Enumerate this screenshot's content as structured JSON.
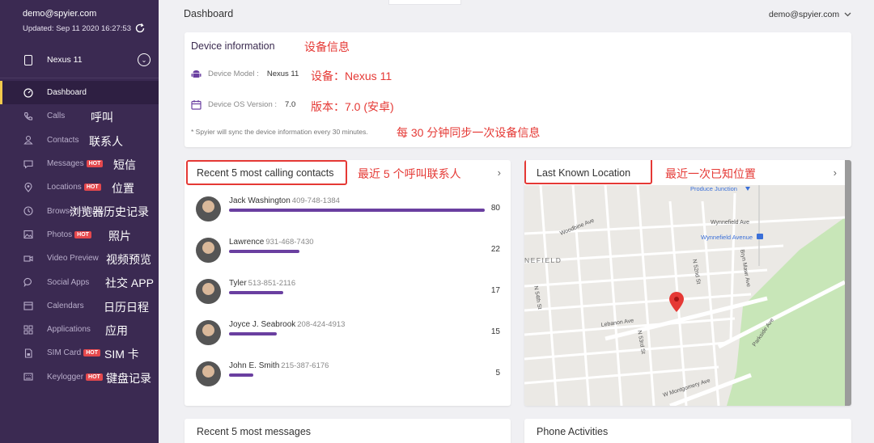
{
  "sidebar": {
    "email": "demo@spyier.com",
    "updated": "Updated: Sep 11 2020 16:27:53",
    "device": "Nexus 11",
    "items": [
      {
        "label": "Dashboard",
        "hot": false,
        "cn": "",
        "icon": "dashboard-icon"
      },
      {
        "label": "Calls",
        "hot": false,
        "cn": "呼叫",
        "icon": "phone-icon"
      },
      {
        "label": "Contacts",
        "hot": false,
        "cn": "联系人",
        "icon": "user-icon"
      },
      {
        "label": "Messages",
        "hot": true,
        "cn": "短信",
        "icon": "message-icon"
      },
      {
        "label": "Locations",
        "hot": true,
        "cn": "位置",
        "icon": "location-icon"
      },
      {
        "label": "Browser History",
        "hot": false,
        "cn": "浏览器历史记录",
        "icon": "clock-icon"
      },
      {
        "label": "Photos",
        "hot": true,
        "cn": "照片",
        "icon": "image-icon"
      },
      {
        "label": "Video Preview",
        "hot": false,
        "cn": "视频预览",
        "icon": "video-icon"
      },
      {
        "label": "Social Apps",
        "hot": false,
        "cn": "社交 APP",
        "icon": "chat-bubble-icon"
      },
      {
        "label": "Calendars",
        "hot": false,
        "cn": "日历日程",
        "icon": "calendar-icon"
      },
      {
        "label": "Applications",
        "hot": false,
        "cn": "应用",
        "icon": "grid-icon"
      },
      {
        "label": "SIM Card",
        "hot": true,
        "cn": "SIM 卡",
        "icon": "sim-icon"
      },
      {
        "label": "Keylogger",
        "hot": true,
        "cn": "键盘记录",
        "icon": "keyboard-icon"
      }
    ],
    "hot_label": "HOT"
  },
  "header": {
    "title": "Dashboard",
    "account": "demo@spyier.com"
  },
  "device_info": {
    "title": "Device information",
    "title_cn": "设备信息",
    "model_label": "Device Model :",
    "model_value": "Nexus 11",
    "model_cn": "设备：Nexus 11",
    "os_label": "Device OS Version :",
    "os_value": "7.0",
    "os_cn": "版本：7.0 (安卓)",
    "note": "* Spyier will sync the device information every 30 minutes.",
    "note_cn": "每 30 分钟同步一次设备信息"
  },
  "contacts": {
    "title": "Recent 5 most calling contacts",
    "title_cn": "最近 5 个呼叫联系人",
    "max": 80,
    "rows": [
      {
        "name": "Jack Washington",
        "phone": "409-748-1384",
        "count": 80
      },
      {
        "name": "Lawrence",
        "phone": "931-468-7430",
        "count": 22
      },
      {
        "name": "Tyler",
        "phone": "513-851-2116",
        "count": 17
      },
      {
        "name": "Joyce J. Seabrook",
        "phone": "208-424-4913",
        "count": 15
      },
      {
        "name": "John E. Smith",
        "phone": "215-387-6176",
        "count": 5
      }
    ]
  },
  "location": {
    "title": "Last Known Location",
    "title_cn": "最近一次已知位置",
    "map_labels": {
      "produce": "Produce Junction",
      "wynnefield": "Wynnefield Ave",
      "wynnefield_ave": "Wynnefield Avenue",
      "district": "NEFIELD",
      "woodbine": "Woodbine Ave",
      "lebanon": "Lebanon Ave",
      "montgomery": "W Montgomery Ave",
      "parkside": "Parkside Ave",
      "bryn": "Bryn Mawr Ave",
      "n54": "N 54th St",
      "n52": "N 52nd St",
      "n53": "N 53rd St"
    }
  },
  "bottom": {
    "messages": "Recent 5 most messages",
    "activities": "Phone Activities"
  },
  "colors": {
    "sidebar": "#3b2a52",
    "accent": "#6a3fa0",
    "annotation": "#e53935",
    "hot": "#e5484d"
  }
}
